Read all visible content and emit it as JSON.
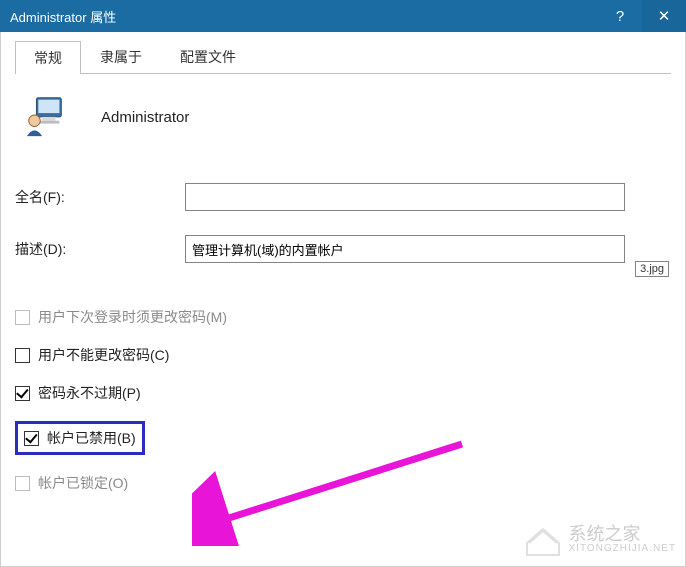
{
  "titlebar": {
    "title": "Administrator 属性",
    "help_symbol": "?",
    "close_symbol": "✕"
  },
  "tabs": {
    "general": "常规",
    "memberof": "隶属于",
    "profile": "配置文件"
  },
  "user": {
    "name": "Administrator"
  },
  "form": {
    "fullname_label": "全名(F):",
    "fullname_value": "",
    "desc_label": "描述(D):",
    "desc_value": "管理计算机(域)的内置帐户"
  },
  "jpg_badge": "3.jpg",
  "checks": {
    "must_change": "用户下次登录时须更改密码(M)",
    "cannot_change": "用户不能更改密码(C)",
    "never_expires": "密码永不过期(P)",
    "disabled": "帐户已禁用(B)",
    "locked": "帐户已锁定(O)"
  },
  "watermark": {
    "text": "系统之家",
    "sub": "XITONGZHIJIA.NET"
  }
}
